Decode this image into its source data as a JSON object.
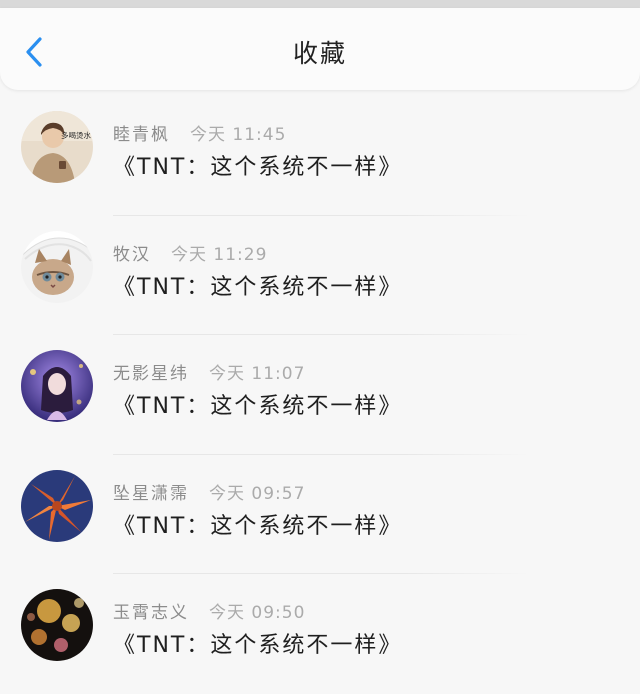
{
  "header": {
    "title": "收藏",
    "back_icon": "chevron-left-icon",
    "accent_color": "#2a8ff0"
  },
  "favorites": [
    {
      "name": "睦青枫",
      "time": "今天 11:45",
      "content": "《TNT：这个系统不一样》",
      "avatar_caption": "多喝烫水"
    },
    {
      "name": "牧汉",
      "time": "今天 11:29",
      "content": "《TNT：这个系统不一样》"
    },
    {
      "name": "无影星纬",
      "time": "今天 11:07",
      "content": "《TNT：这个系统不一样》"
    },
    {
      "name": "坠星潇霈",
      "time": "今天 09:57",
      "content": "《TNT：这个系统不一样》"
    },
    {
      "name": "玉霄志义",
      "time": "今天 09:50",
      "content": "《TNT：这个系统不一样》"
    }
  ]
}
